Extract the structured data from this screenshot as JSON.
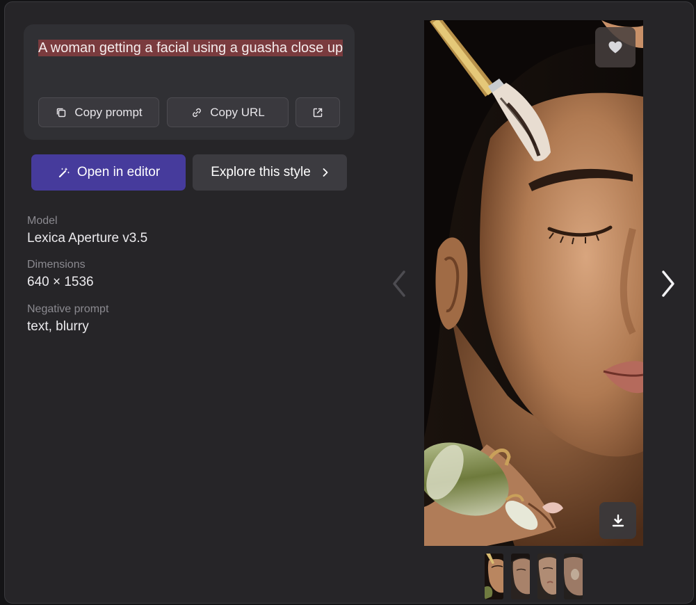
{
  "prompt": {
    "text": "A woman getting a facial using a guasha close up",
    "copy_prompt_label": "Copy prompt",
    "copy_url_label": "Copy URL"
  },
  "actions": {
    "open_editor_label": "Open in editor",
    "explore_style_label": "Explore this style"
  },
  "details": {
    "model_label": "Model",
    "model_value": "Lexica Aperture v3.5",
    "dimensions_label": "Dimensions",
    "dimensions_value": "640 × 1536",
    "negative_label": "Negative prompt",
    "negative_value": "text, blurry"
  },
  "viewer": {
    "image_description": "Close-up of woman with closed eyes, brush applied to forehead, jade roller on jaw",
    "thumbnail_count": 4,
    "active_thumbnail": 0
  },
  "colors": {
    "accent": "#463b9c",
    "highlight": "#7a3b3e",
    "background": "#262528"
  }
}
